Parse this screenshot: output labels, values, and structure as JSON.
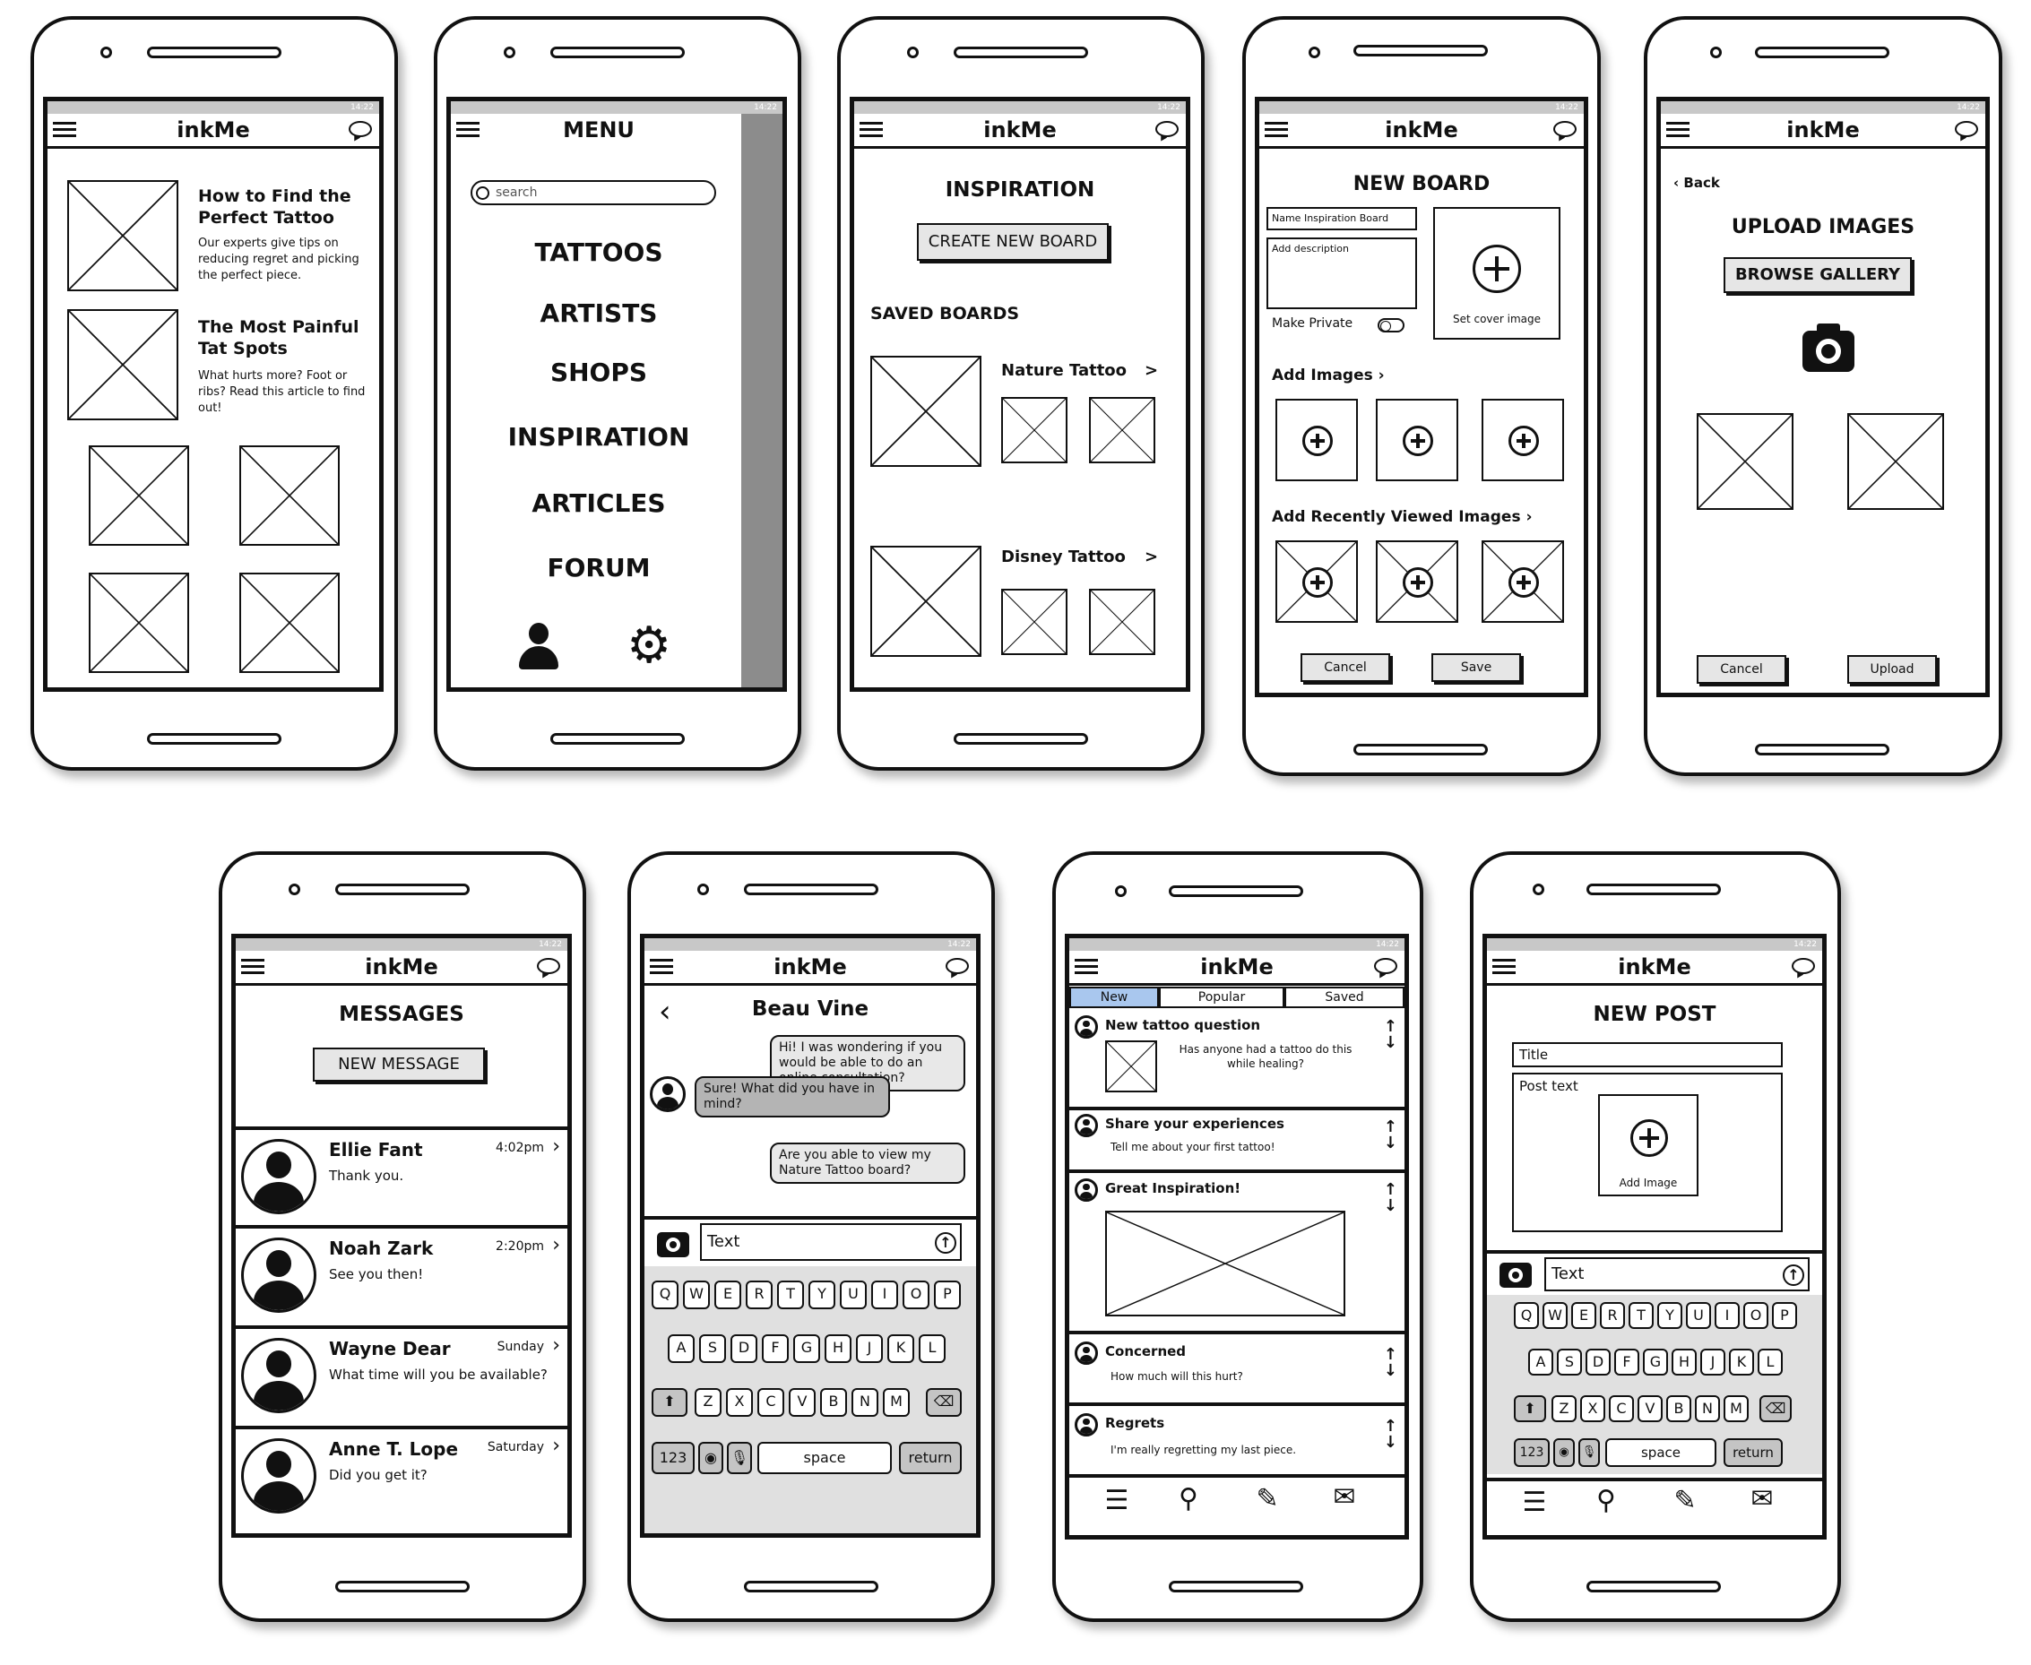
{
  "status_time": "14:22",
  "app_title": "inkMe",
  "home": {
    "articles": [
      {
        "title": "How to Find the Perfect Tattoo",
        "body": "Our experts give tips on reducing regret and picking the perfect piece."
      },
      {
        "title": "The Most Painful Tat Spots",
        "body": "What hurts more? Foot or ribs? Read this article to find out!"
      }
    ]
  },
  "menu": {
    "title": "MENU",
    "search_placeholder": "search",
    "items": [
      "TATTOOS",
      "ARTISTS",
      "SHOPS",
      "INSPIRATION",
      "ARTICLES",
      "FORUM"
    ],
    "icons": [
      "user-icon",
      "gear-icon"
    ]
  },
  "inspiration": {
    "title": "INSPIRATION",
    "create_button": "CREATE NEW BOARD",
    "saved_label": "SAVED BOARDS",
    "boards": [
      {
        "name": "Nature Tattoo",
        "chevron": ">"
      },
      {
        "name": "Disney Tattoo",
        "chevron": ">"
      }
    ]
  },
  "new_board": {
    "title": "NEW BOARD",
    "name_placeholder": "Name Inspiration Board",
    "description_placeholder": "Add description",
    "make_private": "Make Private",
    "cover_label": "Set cover image",
    "add_images": "Add Images",
    "add_recent": "Add Recently Viewed Images",
    "cancel": "Cancel",
    "save": "Save"
  },
  "upload": {
    "back": "Back",
    "title": "UPLOAD IMAGES",
    "browse": "BROWSE GALLERY",
    "cancel": "Cancel",
    "upload": "Upload"
  },
  "messages": {
    "title": "MESSAGES",
    "new_button": "NEW MESSAGE",
    "threads": [
      {
        "name": "Ellie Fant",
        "time": "4:02pm",
        "preview": "Thank you."
      },
      {
        "name": "Noah Zark",
        "time": "2:20pm",
        "preview": "See you then!"
      },
      {
        "name": "Wayne Dear",
        "time": "Sunday",
        "preview": "What time will you be available?"
      },
      {
        "name": "Anne T. Lope",
        "time": "Saturday",
        "preview": "Did you get it?"
      }
    ]
  },
  "conversation": {
    "contact": "Beau Vine",
    "messages": [
      {
        "from": "me",
        "text": "Hi! I was wondering if you would be able to do an online consultation?"
      },
      {
        "from": "them",
        "text": "Sure! What did you have in mind?"
      },
      {
        "from": "me",
        "text": "Are you able to view my Nature Tattoo board?"
      }
    ],
    "input_placeholder": "Text"
  },
  "keyboard": {
    "row1": [
      "Q",
      "W",
      "E",
      "R",
      "T",
      "Y",
      "U",
      "I",
      "O",
      "P"
    ],
    "row2": [
      "A",
      "S",
      "D",
      "F",
      "G",
      "H",
      "J",
      "K",
      "L"
    ],
    "row3": [
      "Z",
      "X",
      "C",
      "V",
      "B",
      "N",
      "M"
    ],
    "num": "123",
    "space": "space",
    "return": "return"
  },
  "forum": {
    "tabs": [
      "New",
      "Popular",
      "Saved"
    ],
    "posts": [
      {
        "title": "New tattoo question",
        "body": "Has anyone had a tattoo do this while healing?"
      },
      {
        "title": "Share your experiences",
        "body": "Tell me about your first tattoo!"
      },
      {
        "title": "Great Inspiration!",
        "body": ""
      },
      {
        "title": "Concerned",
        "body": "How much will this hurt?"
      },
      {
        "title": "Regrets",
        "body": "I'm really regretting my last piece."
      }
    ],
    "nav_icons": [
      "list-icon",
      "search-icon",
      "pencil-icon",
      "mail-icon"
    ]
  },
  "new_post": {
    "title": "NEW POST",
    "title_placeholder": "Title",
    "body_placeholder": "Post text",
    "add_image": "Add Image",
    "input_placeholder": "Text"
  }
}
